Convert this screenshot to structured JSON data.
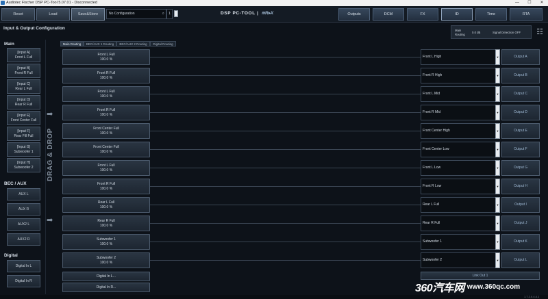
{
  "window": {
    "title": "Audiotec Fischer DSP PC-Tool 5.07.01 - Disconnected",
    "minimize": "—",
    "maximize": "☐",
    "close": "✕"
  },
  "toolbar": {
    "reset_label": "Reset",
    "load_label": "Load",
    "save_store_label": "Save&Store",
    "config_value": "No Configuration",
    "config_number": "1",
    "brand": "DSP PC-TOOL |",
    "brand_mark": "≋R▸X",
    "nav": [
      "Outputs",
      "DCM",
      "FX",
      "ID",
      "Time",
      "RTA"
    ]
  },
  "page": {
    "section_title": "Input & Output Configuration",
    "routing_label_1": "Main",
    "routing_label_2": "Routing",
    "routing_value": "0.0 dB",
    "signal_detection": "Signal Detection OFF",
    "drag_drop": "DRAG & DROP"
  },
  "sidebar": {
    "main_header": "Main",
    "main_inputs": [
      {
        "line1": "[Input A]",
        "line2": "Front L Full"
      },
      {
        "line1": "[Input B]",
        "line2": "Front R Full"
      },
      {
        "line1": "[Input C]",
        "line2": "Rear L Full"
      },
      {
        "line1": "[Input D]",
        "line2": "Rear R Full"
      },
      {
        "line1": "[Input E]",
        "line2": "Front Center Full"
      },
      {
        "line1": "[Input F]",
        "line2": "Rear Fill Full"
      },
      {
        "line1": "[Input G]",
        "line2": "Subwoofer 1"
      },
      {
        "line1": "[Input H]",
        "line2": "Subwoofer 2"
      }
    ],
    "bec_header": "BEC / AUX",
    "bec_inputs": [
      "AUX L",
      "AUX R",
      "AUX2 L",
      "AUX2 R"
    ],
    "digital_header": "Digital",
    "digital_inputs": [
      "Digital In L",
      "Digital In R"
    ]
  },
  "tabs": [
    "Main Routing",
    "BEC/AUX 1 Routing",
    "BEC/AUX 2 Routing",
    "Digital Routing"
  ],
  "routes": [
    {
      "source": "Front L Full",
      "level": "100.0 %",
      "channel": "Front L High",
      "output": "Output A"
    },
    {
      "source": "Front R Full",
      "level": "100.0 %",
      "channel": "Front R High",
      "output": "Output B"
    },
    {
      "source": "Front L Full",
      "level": "100.0 %",
      "channel": "Front L Mid",
      "output": "Output C"
    },
    {
      "source": "Front R Full",
      "level": "100.0 %",
      "channel": "Front R Mid",
      "output": "Output D"
    },
    {
      "source": "Front Center Full",
      "level": "100.0 %",
      "channel": "Front Center High",
      "output": "Output E"
    },
    {
      "source": "Front Center Full",
      "level": "100.0 %",
      "channel": "Front Center Low",
      "output": "Output F"
    },
    {
      "source": "Front L Full",
      "level": "100.0 %",
      "channel": "Front L Low",
      "output": "Output G"
    },
    {
      "source": "Front R Full",
      "level": "100.0 %",
      "channel": "Front R Low",
      "output": "Output H"
    },
    {
      "source": "Rear L Full",
      "level": "100.0 %",
      "channel": "Rear L Full",
      "output": "Output I"
    },
    {
      "source": "Rear R Full",
      "level": "100.0 %",
      "channel": "Rear R Full",
      "output": "Output J"
    },
    {
      "source": "Subwoofer 1",
      "level": "100.0 %",
      "channel": "Subwoofer 1",
      "output": "Output K"
    },
    {
      "source": "Subwoofer 2",
      "level": "100.0 %",
      "channel": "Subwoofer 2",
      "output": "Output L"
    }
  ],
  "extra_sources": [
    "Digital In L...",
    "Digital In R..."
  ],
  "link_out": "Link Out 1",
  "watermark": {
    "logo": "360汽车网",
    "url": "www.360qc.com"
  },
  "footer": "1.7.2.0.4.4.1",
  "icons": {
    "search": "search-icon",
    "file": "file-icon",
    "arrow": "right-arrow-icon",
    "dropdown": "chevron-down-icon",
    "settings": "sliders-icon"
  }
}
